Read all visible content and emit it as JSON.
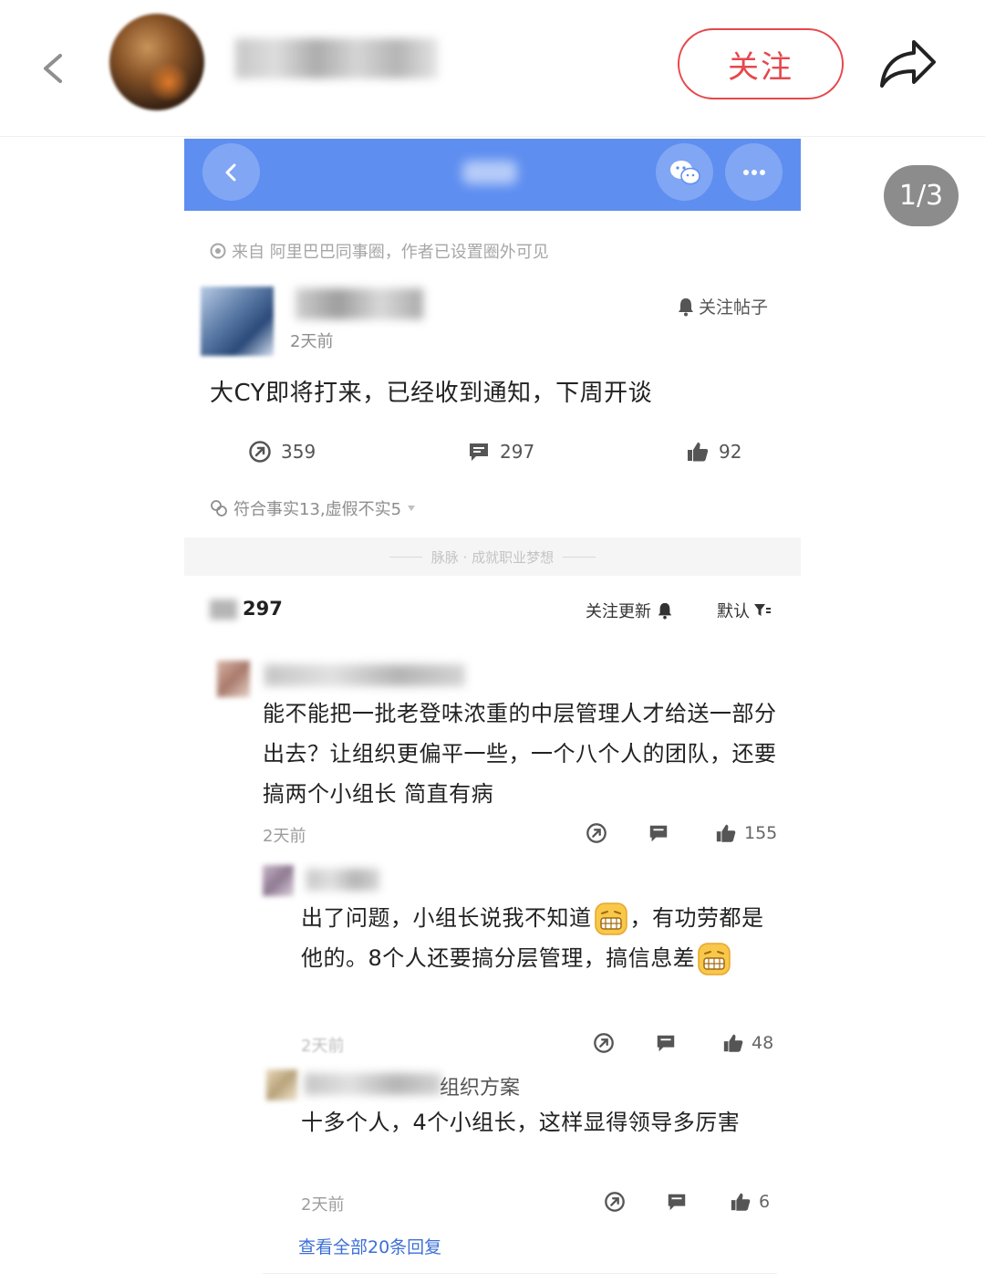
{
  "header": {
    "follow_label": "关注"
  },
  "viewer": {
    "page_counter": "1/3"
  },
  "post": {
    "source": "来自 阿里巴巴同事圈，作者已设置圈外可见",
    "time": "2天前",
    "follow_post_label": "关注帖子",
    "body": "大CY即将打来，已经收到通知，下周开谈",
    "stats": {
      "shares": "359",
      "comments": "297",
      "likes": "92"
    },
    "fact_check": "符合事实13,虚假不实5",
    "slogan": "脉脉 · 成就职业梦想"
  },
  "comments_section": {
    "count": "297",
    "follow_updates_label": "关注更新",
    "sort_label": "默认"
  },
  "comments": [
    {
      "text": "能不能把一批老登味浓重的中层管理人才给送一部分出去？让组织更偏平一些，一个八个人的团队，还要搞两个小组长 简直有病",
      "time": "2天前",
      "likes": "155"
    },
    {
      "text_a": "出了问题，小组长说我不知道",
      "text_b": "，有功劳都是他的。8个人还要搞分层管理，搞信息差",
      "time": "2天前",
      "likes": "48"
    },
    {
      "title_fragment": "组织方案",
      "text": "十多个人，4个小组长，这样显得领导多厉害",
      "time": "2天前",
      "likes": "6"
    }
  ],
  "view_all_replies": "查看全部20条回复",
  "colors": {
    "accent_red": "#e5484d",
    "nav_blue": "#5e8ef0",
    "link_blue": "#3d6fd8"
  },
  "icons": [
    "back-icon",
    "share-icon",
    "wechat-icon",
    "more-icon",
    "bell-icon",
    "share-arrow-icon",
    "comment-icon",
    "thumbs-up-icon",
    "filter-icon",
    "emoji-grin-icon"
  ]
}
